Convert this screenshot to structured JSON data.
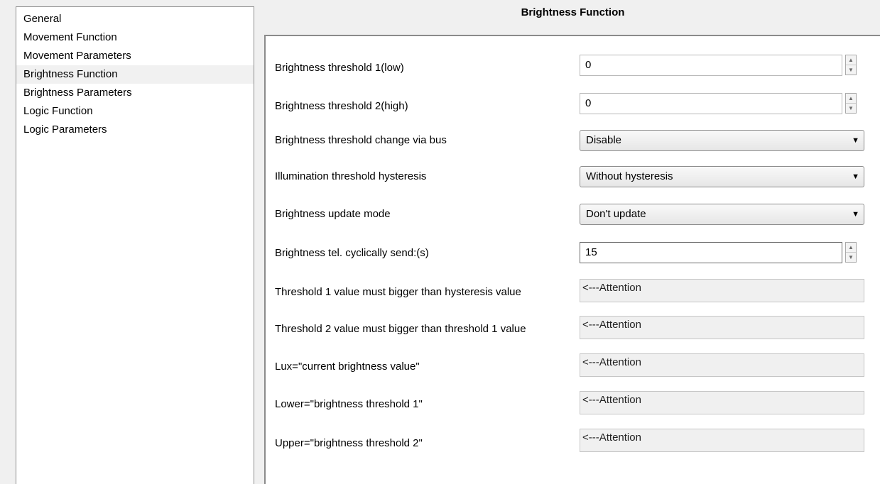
{
  "nav": {
    "items": [
      {
        "label": "General"
      },
      {
        "label": "Movement Function"
      },
      {
        "label": "Movement Parameters"
      },
      {
        "label": "Brightness Function",
        "selected": true
      },
      {
        "label": "Brightness Parameters"
      },
      {
        "label": "Logic Function"
      },
      {
        "label": "Logic Parameters"
      }
    ]
  },
  "page": {
    "title": "Brightness Function"
  },
  "params": {
    "threshold1": {
      "label": "Brightness threshold 1(low)",
      "value": "0"
    },
    "threshold2": {
      "label": "Brightness threshold 2(high)",
      "value": "0"
    },
    "change_via_bus": {
      "label": "Brightness threshold change via bus",
      "value": "Disable"
    },
    "hysteresis": {
      "label": "Illumination threshold hysteresis",
      "value": "Without hysteresis"
    },
    "update_mode": {
      "label": "Brightness update mode",
      "value": "Don't update"
    },
    "cyclic_send": {
      "label": "Brightness tel. cyclically send:(s)",
      "value": "15"
    }
  },
  "notes": [
    {
      "label": "Threshold 1 value must bigger than hysteresis value",
      "value": "<---Attention"
    },
    {
      "label": "Threshold 2 value must bigger than threshold 1 value",
      "value": "<---Attention"
    },
    {
      "label": "Lux=\"current brightness value\"",
      "value": "<---Attention"
    },
    {
      "label": "Lower=\"brightness  threshold 1\"",
      "value": "<---Attention"
    },
    {
      "label": "Upper=\"brightness threshold 2\"",
      "value": "<---Attention"
    }
  ],
  "icons": {
    "spin_up": "▲",
    "spin_down": "▼",
    "dropdown": "▼"
  }
}
